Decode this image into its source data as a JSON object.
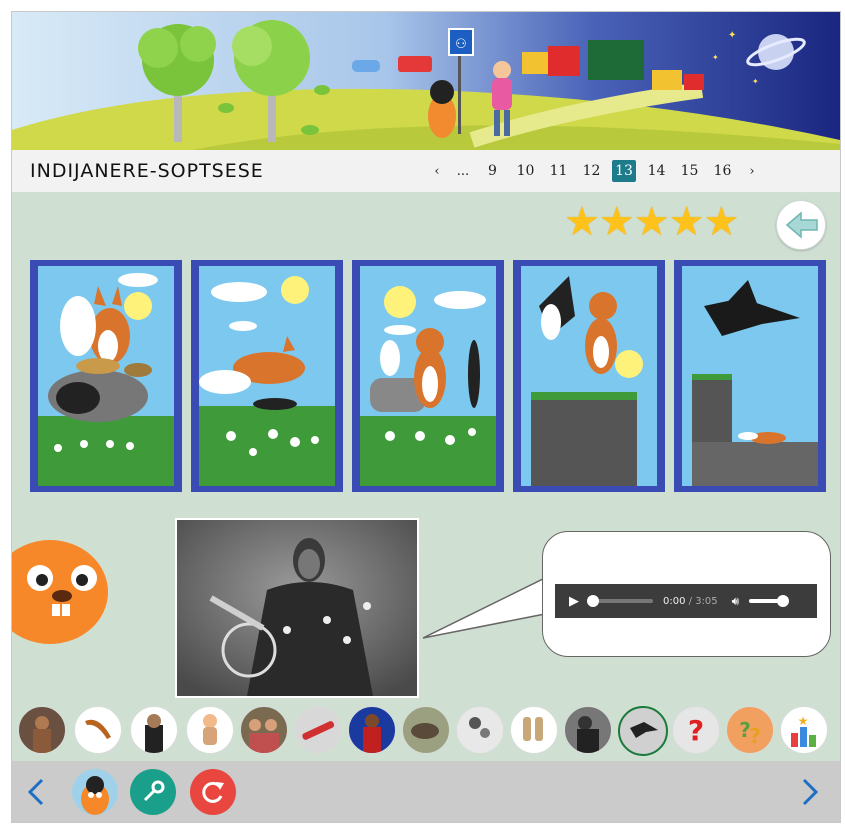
{
  "title": "INDIJANERE-SOPTSESE",
  "pager": {
    "prev": "‹",
    "ellipsis": "...",
    "pages": [
      "9",
      "10",
      "11",
      "12",
      "13",
      "14",
      "15",
      "16"
    ],
    "current": "13",
    "next": "›"
  },
  "rating": {
    "stars": 5,
    "max": 5,
    "glyphs": "★★★★★"
  },
  "story_panels": [
    "fox-sitting-with-basket-and-raven",
    "fox-bending-over-raven",
    "fox-holding-raven",
    "raven-flying-fox-on-cliff",
    "raven-flying-away-fox-fallen"
  ],
  "audio": {
    "current_time": "0:00",
    "separator": " / ",
    "duration": "3:05"
  },
  "topic_icons": [
    "man-photo",
    "boomerang",
    "chief-photo",
    "child-figure",
    "family-photo",
    "pipe",
    "warrior-photo",
    "horse-photo",
    "mother-child-photo",
    "moccasins",
    "elder-photo",
    "raven-icon",
    "question-icon",
    "question-orange-icon",
    "results-star-icon"
  ],
  "topic_icon_selected": 11,
  "colors": {
    "accent_teal": "#1e7b8c",
    "panel_blue": "#3a4bb4",
    "star_yellow": "#ffc21a",
    "arrow_blue": "#1d6fc2",
    "reload_red": "#e8463e",
    "key_green": "#1aa08a"
  }
}
